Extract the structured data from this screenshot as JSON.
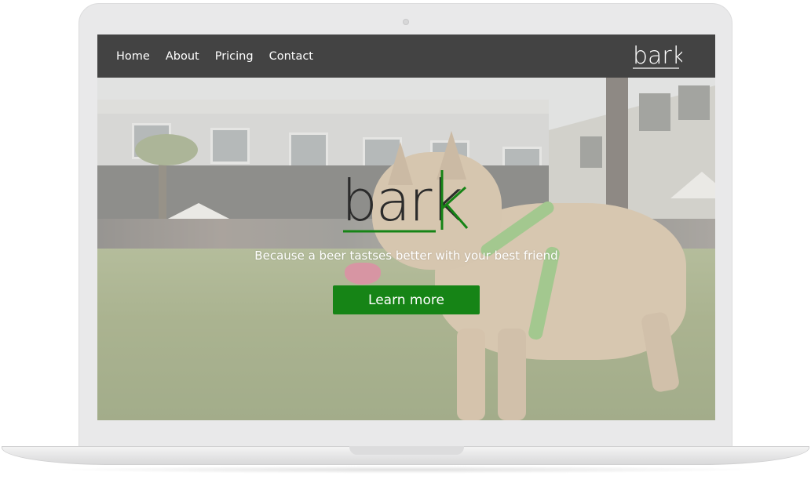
{
  "nav": {
    "links": [
      "Home",
      "About",
      "Pricing",
      "Contact"
    ],
    "logo_text": "bark"
  },
  "hero": {
    "logo_text": "bark",
    "tagline": "Because a beer tastses better with your best friend",
    "cta_label": "Learn more"
  },
  "colors": {
    "navbar_bg": "#434343",
    "accent_green": "#168416",
    "logo_dark": "#2b2b2b"
  }
}
